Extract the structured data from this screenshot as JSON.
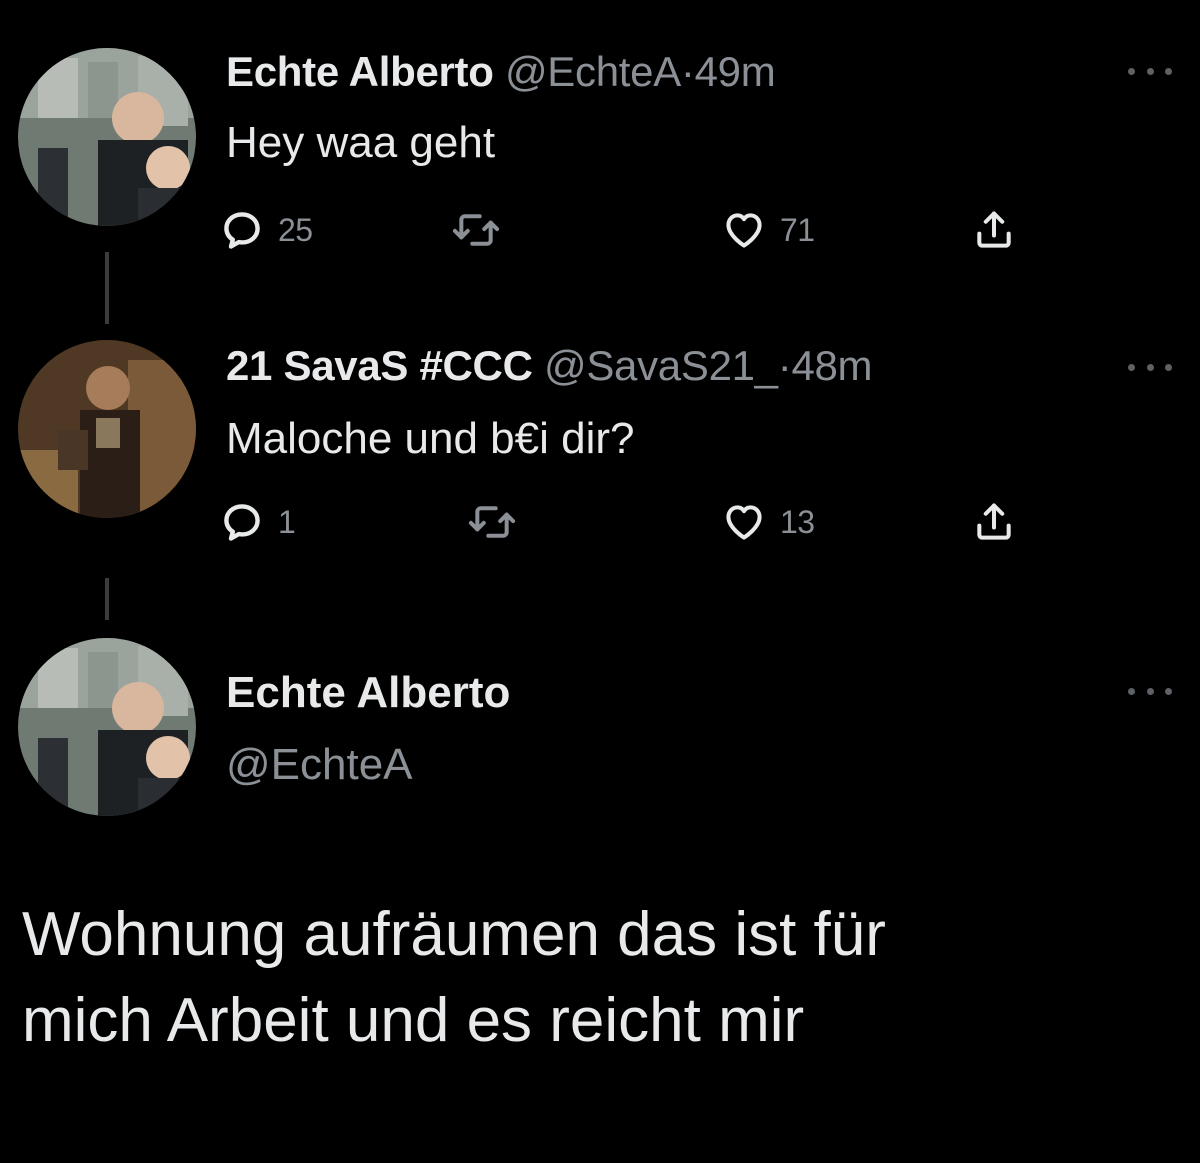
{
  "tweets": [
    {
      "name": "Echte Alberto",
      "handle": "@EchteA",
      "separator": "·",
      "time": "49m",
      "text": "Hey waa geht",
      "replies": "25",
      "retweets": "",
      "likes": "71"
    },
    {
      "name": "21 SavaS #CCC",
      "handle": "@SavaS21_",
      "separator": "·",
      "time": "48m",
      "text": "Maloche und b€i dir?",
      "replies": "1",
      "retweets": "",
      "likes": "13"
    }
  ],
  "main_tweet": {
    "name": "Echte Alberto",
    "handle": "@EchteA",
    "text_lines": [
      "Wohnung aufräumen das ist für",
      "mich Arbeit und es reicht mir"
    ]
  },
  "icons": {
    "reply": "reply-icon",
    "retweet": "retweet-icon",
    "like": "heart-icon",
    "share": "share-icon",
    "more": "more-options-icon"
  },
  "colors": {
    "background": "#000000",
    "text_primary": "#e7e9ea",
    "text_secondary": "#8b9096",
    "thread_line": "#3a3d40"
  }
}
